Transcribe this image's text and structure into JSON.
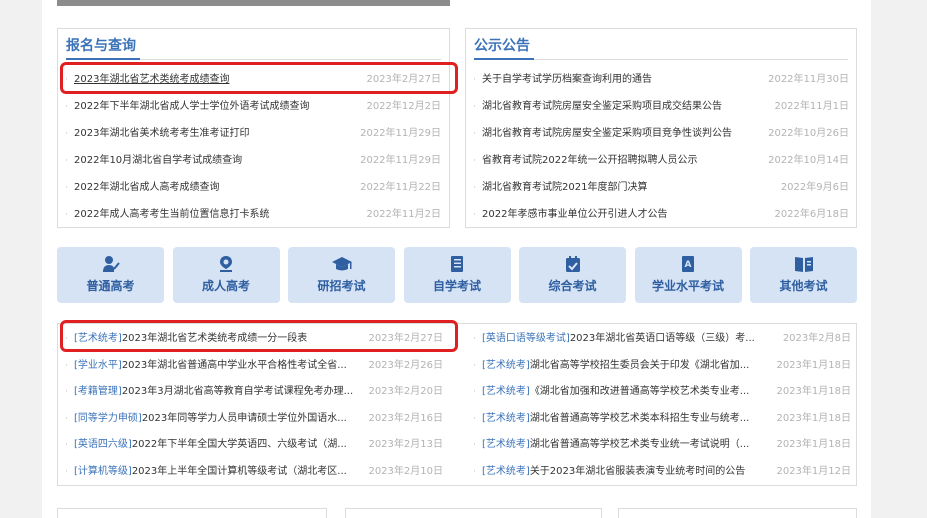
{
  "signup": {
    "title": "报名与查询",
    "items": [
      {
        "text": "2023年湖北省艺术类统考成绩查询",
        "date": "2023年2月27日"
      },
      {
        "text": "2022年下半年湖北省成人学士学位外语考试成绩查询",
        "date": "2022年12月2日"
      },
      {
        "text": "2023年湖北省美术统考考生准考证打印",
        "date": "2022年11月29日"
      },
      {
        "text": "2022年10月湖北省自学考试成绩查询",
        "date": "2022年11月29日"
      },
      {
        "text": "2022年湖北省成人高考成绩查询",
        "date": "2022年11月22日"
      },
      {
        "text": "2022年成人高考考生当前位置信息打卡系统",
        "date": "2022年11月2日"
      }
    ]
  },
  "notice": {
    "title": "公示公告",
    "items": [
      {
        "text": "关于自学考试学历档案查询利用的通告",
        "date": "2022年11月30日"
      },
      {
        "text": "湖北省教育考试院房屋安全鉴定采购项目成交结果公告",
        "date": "2022年11月1日"
      },
      {
        "text": "湖北省教育考试院房屋安全鉴定采购项目竞争性谈判公告",
        "date": "2022年10月26日"
      },
      {
        "text": "省教育考试院2022年统一公开招聘拟聘人员公示",
        "date": "2022年10月14日"
      },
      {
        "text": "湖北省教育考试院2021年度部门决算",
        "date": "2022年9月6日"
      },
      {
        "text": "2022年孝感市事业单位公开引进人才公告",
        "date": "2022年6月18日"
      }
    ]
  },
  "categories": [
    {
      "label": "普通高考",
      "icon": "person-writing-icon"
    },
    {
      "label": "成人高考",
      "icon": "location-pin-icon"
    },
    {
      "label": "研招考试",
      "icon": "graduation-cap-icon"
    },
    {
      "label": "自学考试",
      "icon": "book-icon"
    },
    {
      "label": "综合考试",
      "icon": "calendar-check-icon"
    },
    {
      "label": "学业水平考试",
      "icon": "document-a-icon"
    },
    {
      "label": "其他考试",
      "icon": "open-book-icon"
    }
  ],
  "news_left": [
    {
      "tag": "[艺术统考]",
      "text": "2023年湖北省艺术类统考成绩一分一段表",
      "date": "2023年2月27日"
    },
    {
      "tag": "[学业水平]",
      "text": "2023年湖北省普通高中学业水平合格性考试全省...",
      "date": "2023年2月26日"
    },
    {
      "tag": "[考籍管理]",
      "text": "2023年3月湖北省高等教育自学考试课程免考办理...",
      "date": "2023年2月20日"
    },
    {
      "tag": "[同等学力申硕]",
      "text": "2023年同等学力人员申请硕士学位外国语水...",
      "date": "2023年2月16日"
    },
    {
      "tag": "[英语四六级]",
      "text": "2022年下半年全国大学英语四、六级考试（湖...",
      "date": "2023年2月13日"
    },
    {
      "tag": "[计算机等级]",
      "text": "2023年上半年全国计算机等级考试（湖北考区...",
      "date": "2023年2月10日"
    }
  ],
  "news_right": [
    {
      "tag": "[英语口语等级考试]",
      "text": "2023年湖北省英语口语等级（三级）考...",
      "date": "2023年2月8日"
    },
    {
      "tag": "[艺术统考]",
      "text": "湖北省高等学校招生委员会关于印发《湖北省加...",
      "date": "2023年1月18日"
    },
    {
      "tag": "[艺术统考]",
      "text": "《湖北省加强和改进普通高等学校艺术类专业考...",
      "date": "2023年1月18日"
    },
    {
      "tag": "[艺术统考]",
      "text": "湖北省普通高等学校艺术类本科招生专业与统考...",
      "date": "2023年1月18日"
    },
    {
      "tag": "[艺术统考]",
      "text": "湖北省普通高等学校艺术类专业统一考试说明（...",
      "date": "2023年1月18日"
    },
    {
      "tag": "[艺术统考]",
      "text": "关于2023年湖北省服装表演专业统考时间的公告",
      "date": "2023年1月12日"
    }
  ],
  "colors": {
    "accent": "#3b73b9",
    "highlight": "#e02020",
    "button_bg": "#d6e3f4"
  }
}
